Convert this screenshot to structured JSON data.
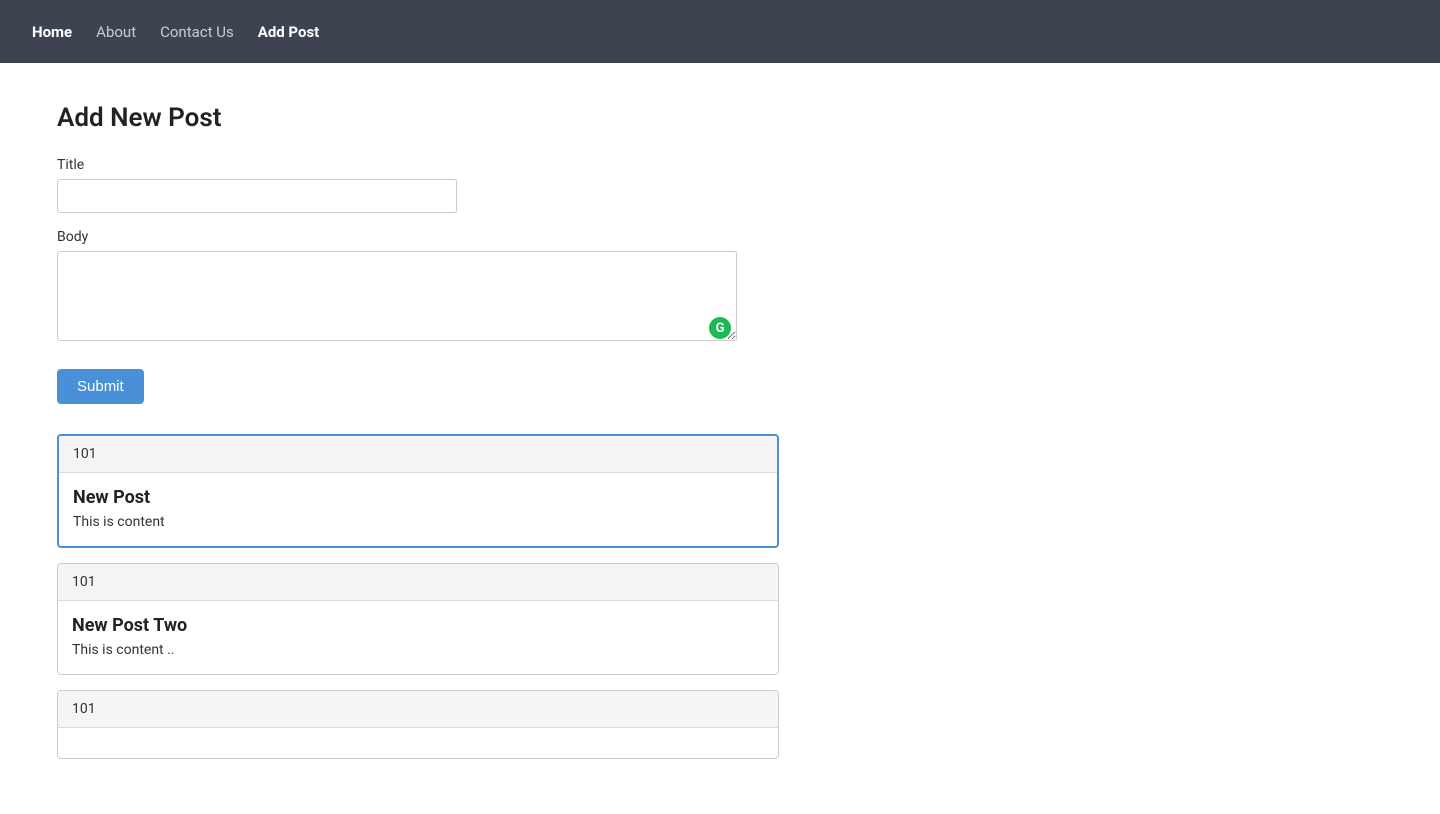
{
  "nav": {
    "home_label": "Home",
    "about_label": "About",
    "contact_label": "Contact Us",
    "add_post_label": "Add Post"
  },
  "page": {
    "title": "Add New Post"
  },
  "form": {
    "title_label": "Title",
    "title_placeholder": "",
    "body_label": "Body",
    "body_placeholder": "",
    "submit_label": "Submit"
  },
  "posts": [
    {
      "id": "101",
      "title": "New Post",
      "content": "This is content",
      "highlighted": true
    },
    {
      "id": "101",
      "title": "New Post Two",
      "content": "This is content ..",
      "highlighted": false
    },
    {
      "id": "101",
      "title": "",
      "content": "",
      "highlighted": false
    }
  ]
}
